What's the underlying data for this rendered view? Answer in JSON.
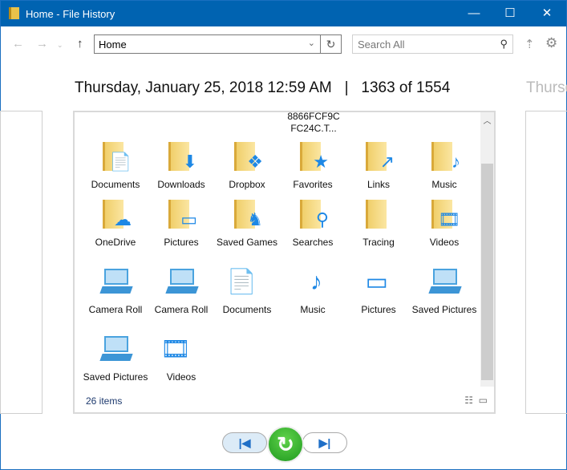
{
  "window": {
    "title": "Home - File History"
  },
  "toolbar": {
    "address": "Home",
    "search_placeholder": "Search All"
  },
  "header": {
    "date": "Thursday, January 25, 2018 12:59 AM",
    "separator": "|",
    "position": "1363 of 1554",
    "next_date": "Thursday"
  },
  "panel": {
    "partial_item": "8866FCF9C FC24C.T...",
    "items": [
      {
        "label": "Documents",
        "icon": "documents-folder-icon",
        "glyph": "📄",
        "type": "folder"
      },
      {
        "label": "Downloads",
        "icon": "downloads-folder-icon",
        "glyph": "⬇",
        "type": "folder"
      },
      {
        "label": "Dropbox",
        "icon": "dropbox-folder-icon",
        "glyph": "❖",
        "type": "folder"
      },
      {
        "label": "Favorites",
        "icon": "favorites-folder-icon",
        "glyph": "★",
        "type": "folder"
      },
      {
        "label": "Links",
        "icon": "links-folder-icon",
        "glyph": "↗",
        "type": "folder"
      },
      {
        "label": "Music",
        "icon": "music-folder-icon",
        "glyph": "♪",
        "type": "folder"
      },
      {
        "label": "OneDrive",
        "icon": "onedrive-folder-icon",
        "glyph": "☁",
        "type": "folder"
      },
      {
        "label": "Pictures",
        "icon": "pictures-folder-icon",
        "glyph": "▭",
        "type": "folder"
      },
      {
        "label": "Saved Games",
        "icon": "saved-games-folder-icon",
        "glyph": "♞",
        "type": "folder"
      },
      {
        "label": "Searches",
        "icon": "searches-folder-icon",
        "glyph": "⚲",
        "type": "folder"
      },
      {
        "label": "Tracing",
        "icon": "tracing-folder-icon",
        "glyph": "",
        "type": "folder"
      },
      {
        "label": "Videos",
        "icon": "videos-folder-icon",
        "glyph": "🎞",
        "type": "folder"
      },
      {
        "label": "Camera Roll",
        "icon": "library-drive-icon",
        "glyph": "",
        "type": "drive"
      },
      {
        "label": "Camera Roll",
        "icon": "library-drive-icon",
        "glyph": "",
        "type": "drive"
      },
      {
        "label": "Documents",
        "icon": "documents-library-icon",
        "glyph": "📄",
        "type": "plain"
      },
      {
        "label": "Music",
        "icon": "music-library-icon",
        "glyph": "♪",
        "type": "plain"
      },
      {
        "label": "Pictures",
        "icon": "pictures-library-icon",
        "glyph": "▭",
        "type": "plain"
      },
      {
        "label": "Saved Pictures",
        "icon": "library-drive-icon",
        "glyph": "",
        "type": "drive"
      },
      {
        "label": "Saved Pictures",
        "icon": "library-drive-icon",
        "glyph": "",
        "type": "drive"
      },
      {
        "label": "Videos",
        "icon": "videos-library-icon",
        "glyph": "🎞",
        "type": "plain"
      }
    ],
    "status": "26 items"
  },
  "colors": {
    "titlebar": "#0063b1",
    "accent": "#1f6fc7",
    "restore": "#2fb52f"
  }
}
